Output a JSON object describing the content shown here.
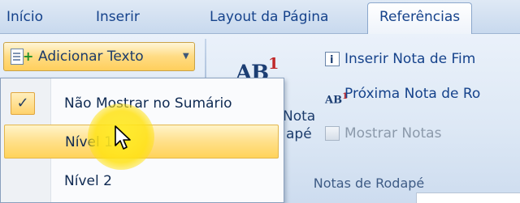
{
  "tabs": [
    {
      "label": "Início",
      "active": false
    },
    {
      "label": "Inserir",
      "active": false
    },
    {
      "label": "Layout da Página",
      "active": false
    },
    {
      "label": "Referências",
      "active": true
    }
  ],
  "ribbon": {
    "add_text_button": {
      "label": "Adicionar Texto",
      "icon": "add-text-icon"
    },
    "footnote_group": {
      "insert_footnote_icon_text": "AB",
      "insert_footnote_icon_sup": "1",
      "insert_footnote_label_line1": "Nota",
      "insert_footnote_label_line2": "apé",
      "insert_endnote": "Inserir Nota de Fim",
      "next_footnote": "Próxima Nota de Ro",
      "next_footnote_icon_text": "AB",
      "next_footnote_icon_sup": "1",
      "show_notes": "Mostrar Notas",
      "title": "Notas de Rodapé"
    }
  },
  "dropdown": {
    "items": [
      {
        "label": "Não Mostrar no Sumário",
        "checked": true
      },
      {
        "label": "Nível 1",
        "hovered": true
      },
      {
        "label": "Nível 2"
      }
    ],
    "check_glyph": "✓"
  },
  "colors": {
    "highlight": "#ffd35a",
    "cursor_glow": "#ffe814",
    "ribbon_text": "#15428b",
    "superscript_red": "#c0282a"
  }
}
